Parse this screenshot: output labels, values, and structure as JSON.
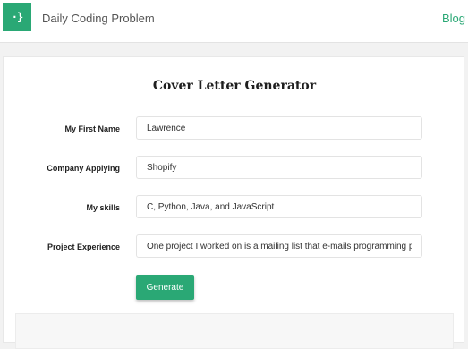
{
  "header": {
    "logo_glyph": "·}",
    "brand_name": "Daily Coding Problem",
    "blog_link": "Blog"
  },
  "form": {
    "title": "Cover Letter Generator",
    "fields": [
      {
        "label": "My First Name",
        "value": "Lawrence"
      },
      {
        "label": "Company Applying",
        "value": "Shopify"
      },
      {
        "label": "My skills",
        "value": "C, Python, Java, and JavaScript"
      },
      {
        "label": "Project Experience",
        "value": "One project I worked on is a mailing list that e-mails programming p"
      }
    ],
    "generate_label": "Generate"
  },
  "colors": {
    "accent": "#2aa875",
    "page_background": "#f2f2f2"
  }
}
